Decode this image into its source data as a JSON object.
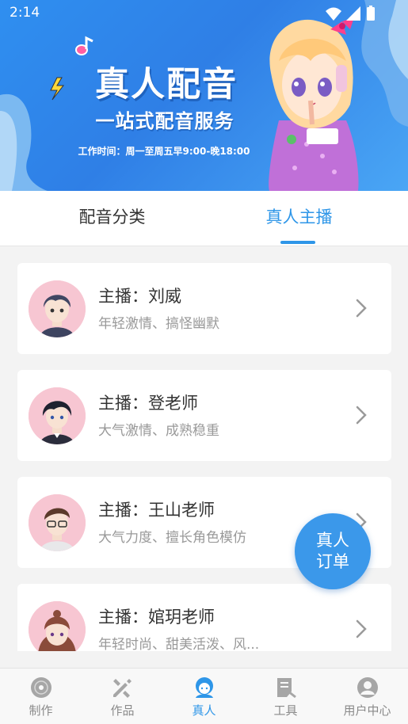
{
  "status_bar": {
    "time": "2:14"
  },
  "banner": {
    "title": "真人配音",
    "subtitle": "一站式配音服务",
    "hours": "工作时间：周一至周五早9:00-晚18:00"
  },
  "tabs": [
    {
      "label": "配音分类",
      "active": false
    },
    {
      "label": "真人主播",
      "active": true
    }
  ],
  "hosts": [
    {
      "name": "主播：刘威",
      "desc": "年轻激情、搞怪幽默"
    },
    {
      "name": "主播：登老师",
      "desc": "大气激情、成熟稳重"
    },
    {
      "name": "主播：王山老师",
      "desc": "大气力度、擅长角色模仿"
    },
    {
      "name": "主播：婠玥老师",
      "desc": "年轻时尚、甜美活泼、风..."
    }
  ],
  "fab": {
    "line1": "真人",
    "line2": "订单"
  },
  "nav": [
    {
      "label": "制作",
      "icon": "disc-icon"
    },
    {
      "label": "作品",
      "icon": "works-icon"
    },
    {
      "label": "真人",
      "icon": "person-icon",
      "active": true
    },
    {
      "label": "工具",
      "icon": "tools-icon"
    },
    {
      "label": "用户中心",
      "icon": "user-icon"
    }
  ],
  "colors": {
    "accent": "#2e96e8",
    "banner": "#2f86ec",
    "background": "#f3f3f3"
  }
}
